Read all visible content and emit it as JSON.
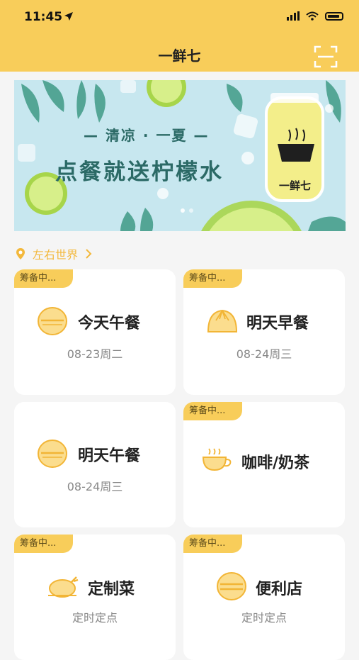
{
  "status": {
    "time": "11:45"
  },
  "app": {
    "title": "一鲜七"
  },
  "banner": {
    "line1": "— 清凉 · 一夏 —",
    "line2": "点餐就送柠檬水",
    "jar_label": "一鲜七",
    "colors": {
      "bg": "#c7e7ef",
      "text": "#2b6a66",
      "lime": "#9acd4a"
    }
  },
  "location": {
    "name": "左右世界",
    "icon": "location-pin-icon"
  },
  "badge_text": "筹备中...",
  "cards": [
    {
      "title": "今天午餐",
      "subtitle": "08-23周二",
      "badge": true,
      "icon": "bowl-icon"
    },
    {
      "title": "明天早餐",
      "subtitle": "08-24周三",
      "badge": true,
      "icon": "bun-icon"
    },
    {
      "title": "明天午餐",
      "subtitle": "08-24周三",
      "badge": false,
      "icon": "bowl-icon"
    },
    {
      "title": "咖啡/奶茶",
      "subtitle": "",
      "badge": true,
      "icon": "coffee-cup-icon"
    },
    {
      "title": "定制菜",
      "subtitle": "定时定点",
      "badge": true,
      "icon": "roast-chicken-icon"
    },
    {
      "title": "便利店",
      "subtitle": "定时定点",
      "badge": true,
      "icon": "burger-icon"
    }
  ],
  "colors": {
    "accent": "#f8cd5a",
    "icon_fill": "#fbdd8e",
    "icon_stroke": "#f2b536"
  }
}
